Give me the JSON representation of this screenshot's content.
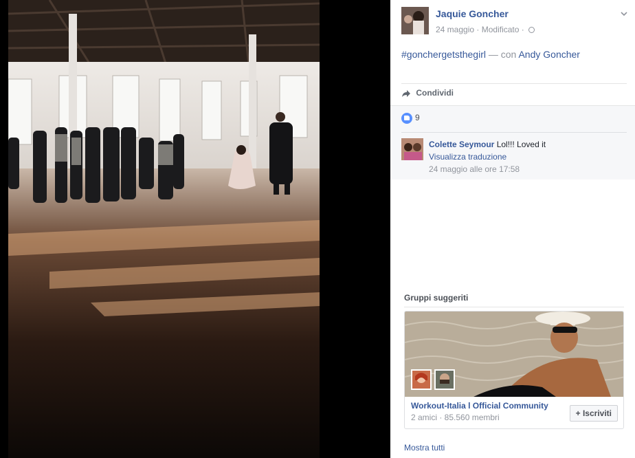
{
  "post": {
    "author": "Jaquie Goncher",
    "date": "24 maggio",
    "separator": "·",
    "edited": "Modificato",
    "hashtag": "#gonchergetsthegirl",
    "with_text": "— con",
    "tagged_friend": "Andy Goncher",
    "share_label": "Condividi",
    "like_count": "9"
  },
  "comment": {
    "author": "Colette Seymour",
    "text": "Lol!!! Loved it",
    "translate_label": "Visualizza traduzione",
    "timestamp": "24 maggio alle ore 17:58"
  },
  "suggested_groups": {
    "title": "Gruppi suggeriti",
    "group": {
      "name": "Workout-Italia l Official Community",
      "meta": "2 amici · 85.560 membri",
      "join_label": "+ Iscriviti"
    },
    "see_all_label": "Mostra tutti"
  },
  "colors": {
    "link_blue": "#365899",
    "muted_gray": "#90949c",
    "like_blue": "#5890ff",
    "panel_bg": "#ffffff",
    "comments_bg": "#f6f7f9"
  },
  "icons": {
    "share": "share-arrow-icon",
    "like": "thumbs-up-icon",
    "audience": "globe-icon",
    "options": "chevron-down-icon"
  }
}
